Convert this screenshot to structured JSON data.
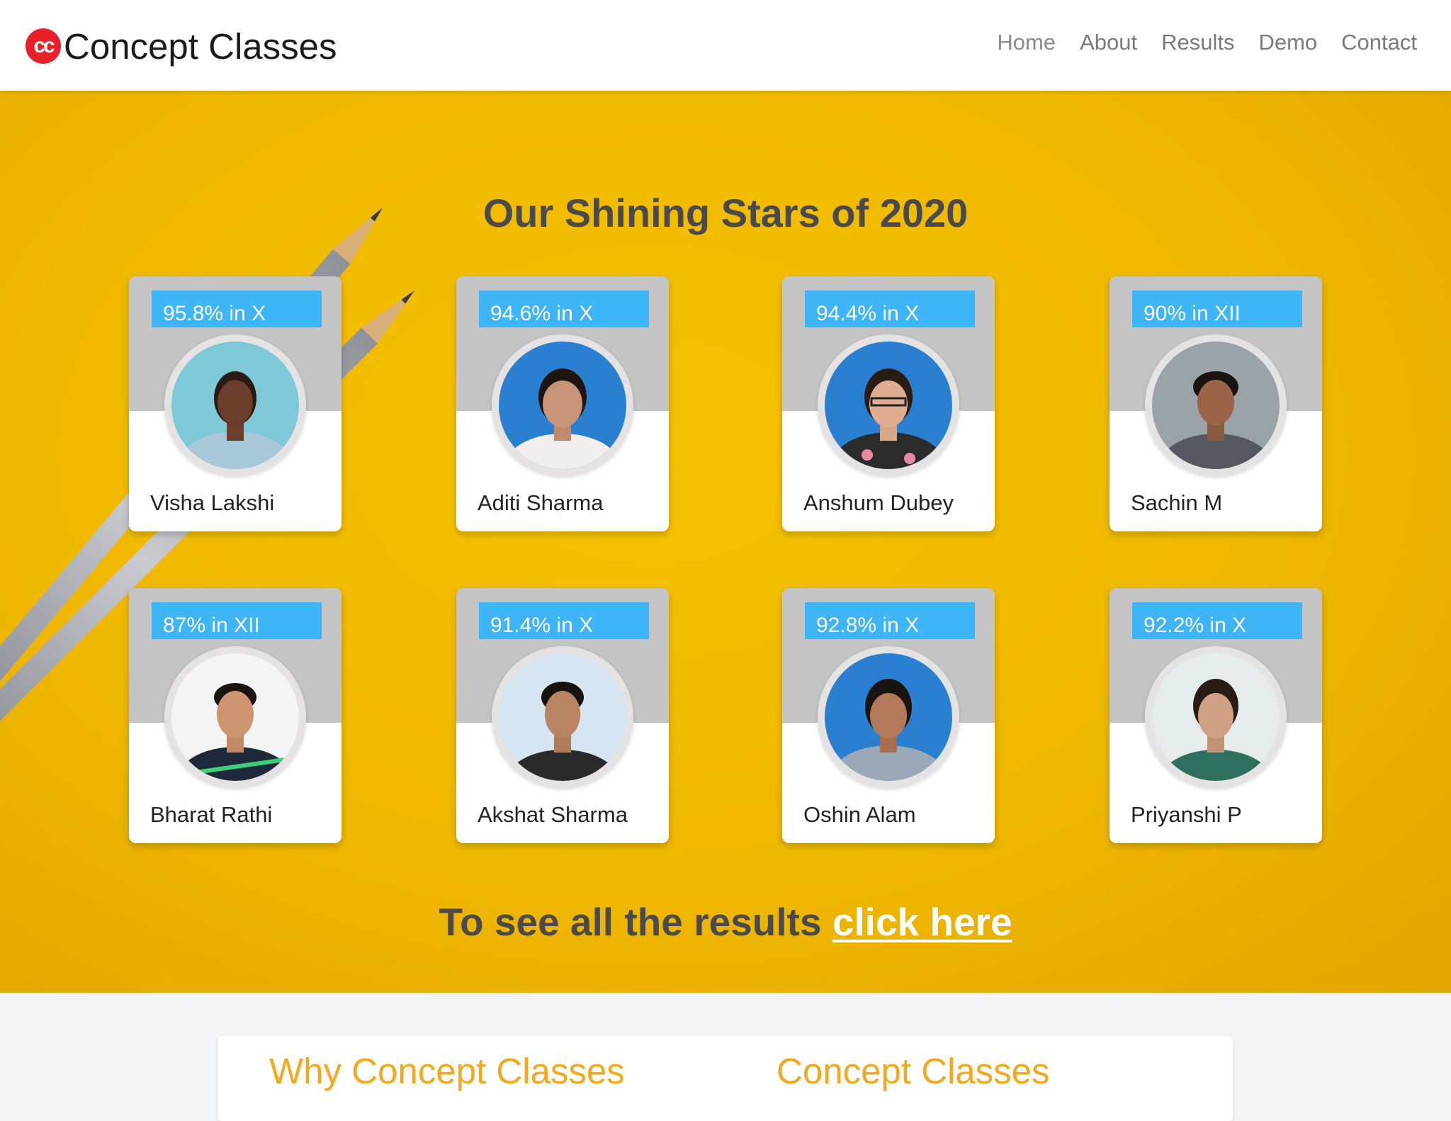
{
  "nav": {
    "logo_text": "cc",
    "brand": "Concept Classes",
    "links": [
      "Home",
      "About",
      "Results",
      "Demo",
      "Contact"
    ]
  },
  "hero": {
    "title": "Our Shining Stars of 2020",
    "students": [
      {
        "score": "95.8% in X",
        "name": "Visha Lakshi"
      },
      {
        "score": "94.6% in X",
        "name": "Aditi Sharma"
      },
      {
        "score": "94.4% in X",
        "name": "Anshum Dubey"
      },
      {
        "score": "90% in XII",
        "name": "Sachin M"
      },
      {
        "score": "87% in XII",
        "name": "Bharat Rathi"
      },
      {
        "score": "91.4% in X",
        "name": "Akshat Sharma"
      },
      {
        "score": "92.8% in X",
        "name": "Oshin Alam"
      },
      {
        "score": "92.2% in X",
        "name": "Priyanshi P"
      }
    ],
    "cta_text": "To see all the results ",
    "cta_link": "click here"
  },
  "bottom": {
    "col1_title": "Why Concept Classes",
    "col2_title": "Concept Classes"
  },
  "colors": {
    "accent_blue": "#3db5f7",
    "hero_yellow": "#f2bc00",
    "heading_orange": "#f4a81d",
    "logo_red": "#e8202a"
  }
}
